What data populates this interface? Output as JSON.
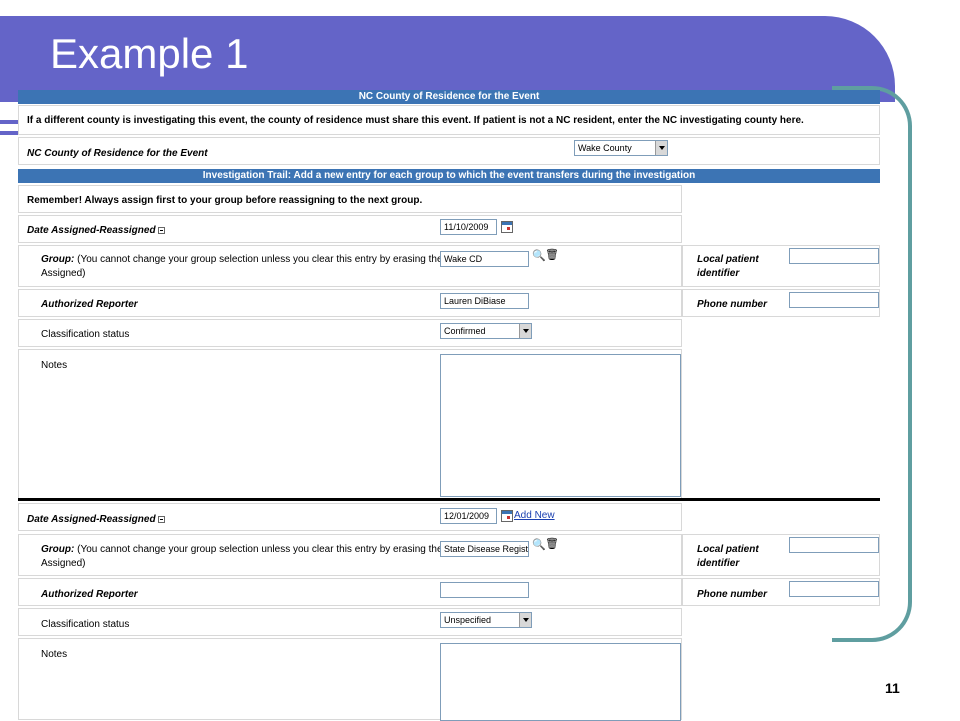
{
  "slide": {
    "title": "Example 1",
    "number": "11"
  },
  "form": {
    "residence_header": "NC County of Residence for the Event",
    "residence_note": "If a different county is investigating this event, the county of residence must share this event. If patient is not a NC resident, enter the NC investigating county here.",
    "residence_label": "NC County of Residence for the Event",
    "residence_value": "Wake County",
    "trail_header": "Investigation Trail: Add a new entry for each group to which the event transfers during the investigation",
    "reminder": "Remember! Always assign first to your group before reassigning to the next group.",
    "entries": [
      {
        "date_label": "Date Assigned-Reassigned",
        "date_value": "11/10/2009",
        "group_label": "Group:",
        "group_note": "(You cannot change your group selection unless you clear this entry by erasing the Date",
        "group_note2": "Assigned)",
        "group_value": "Wake CD",
        "local_id_label": "Local patient",
        "local_id_label2": "identifier",
        "local_id_value": "",
        "reporter_label": "Authorized Reporter",
        "reporter_value": "Lauren DiBiase",
        "phone_label": "Phone number",
        "phone_value": "",
        "status_label": "Classification status",
        "status_value": "Confirmed",
        "notes_label": "Notes"
      },
      {
        "date_label": "Date Assigned-Reassigned",
        "date_value": "12/01/2009",
        "add_new": "Add New",
        "group_label": "Group:",
        "group_note": "(You cannot change your group selection unless you clear this entry by erasing the Date",
        "group_note2": "Assigned)",
        "group_value": "State Disease Registrar",
        "local_id_label": "Local patient",
        "local_id_label2": "identifier",
        "local_id_value": "",
        "reporter_label": "Authorized Reporter",
        "reporter_value": "",
        "phone_label": "Phone number",
        "phone_value": "",
        "status_label": "Classification status",
        "status_value": "Unspecified",
        "notes_label": "Notes"
      }
    ]
  },
  "colors": {
    "header_purple": "#6464c8",
    "section_blue": "#3c74b4",
    "frame_teal": "#5f9ea0"
  }
}
